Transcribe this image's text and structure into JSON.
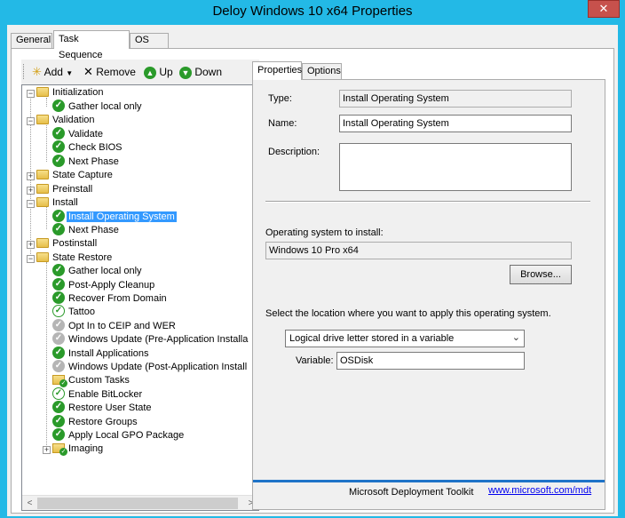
{
  "window": {
    "title": "Deloy Windows 10 x64 Properties",
    "close_glyph": "✕"
  },
  "top_tabs": [
    {
      "label": "General"
    },
    {
      "label": "Task Sequence"
    },
    {
      "label": "OS Info"
    }
  ],
  "toolbar": {
    "add_label": "Add",
    "remove_label": "Remove",
    "up_label": "Up",
    "down_label": "Down"
  },
  "tree": [
    {
      "label": "Initialization",
      "icon": "folder-icon"
    },
    {
      "label": "Gather local only",
      "icon": "check-icon"
    },
    {
      "label": "Validation",
      "icon": "folder-icon"
    },
    {
      "label": "Validate",
      "icon": "check-icon"
    },
    {
      "label": "Check BIOS",
      "icon": "check-icon"
    },
    {
      "label": "Next Phase",
      "icon": "check-icon"
    },
    {
      "label": "State Capture",
      "icon": "folder-icon"
    },
    {
      "label": "Preinstall",
      "icon": "folder-icon"
    },
    {
      "label": "Install",
      "icon": "folder-icon"
    },
    {
      "label": "Install Operating System",
      "icon": "check-icon"
    },
    {
      "label": "Next Phase",
      "icon": "check-icon"
    },
    {
      "label": "Postinstall",
      "icon": "folder-icon"
    },
    {
      "label": "State Restore",
      "icon": "folder-icon"
    },
    {
      "label": "Gather local only",
      "icon": "check-icon"
    },
    {
      "label": "Post-Apply Cleanup",
      "icon": "check-icon"
    },
    {
      "label": "Recover From Domain",
      "icon": "check-icon"
    },
    {
      "label": "Tattoo",
      "icon": "check-outline-icon"
    },
    {
      "label": "Opt In to CEIP and WER",
      "icon": "disabled-icon"
    },
    {
      "label": "Windows Update (Pre-Application Installa",
      "icon": "disabled-icon"
    },
    {
      "label": "Install Applications",
      "icon": "check-icon"
    },
    {
      "label": "Windows Update (Post-Application Install",
      "icon": "disabled-icon"
    },
    {
      "label": "Custom Tasks",
      "icon": "folder-check-icon"
    },
    {
      "label": "Enable BitLocker",
      "icon": "check-outline-icon"
    },
    {
      "label": "Restore User State",
      "icon": "check-icon"
    },
    {
      "label": "Restore Groups",
      "icon": "check-icon"
    },
    {
      "label": "Apply Local GPO Package",
      "icon": "check-icon"
    },
    {
      "label": "Imaging",
      "icon": "folder-check-icon"
    }
  ],
  "right_tabs": [
    {
      "label": "Properties"
    },
    {
      "label": "Options"
    }
  ],
  "properties": {
    "type_label": "Type:",
    "type_value": "Install Operating System",
    "name_label": "Name:",
    "name_value": "Install Operating System",
    "description_label": "Description:",
    "description_value": "",
    "os_label": "Operating system to install:",
    "os_value": "Windows 10 Pro x64",
    "browse_label": "Browse...",
    "location_label": "Select the location where you want to apply this operating system.",
    "location_value": "Logical drive letter stored in a variable",
    "variable_label": "Variable:",
    "variable_value": "OSDisk"
  },
  "footer": {
    "brand": "Microsoft Deployment Toolkit",
    "link": "www.microsoft.com/mdt"
  },
  "colors": {
    "title_bar": "#23b9e6",
    "selection": "#3399ff",
    "footer_rule": "#1e73c8",
    "check_green": "#2a9a2a"
  }
}
